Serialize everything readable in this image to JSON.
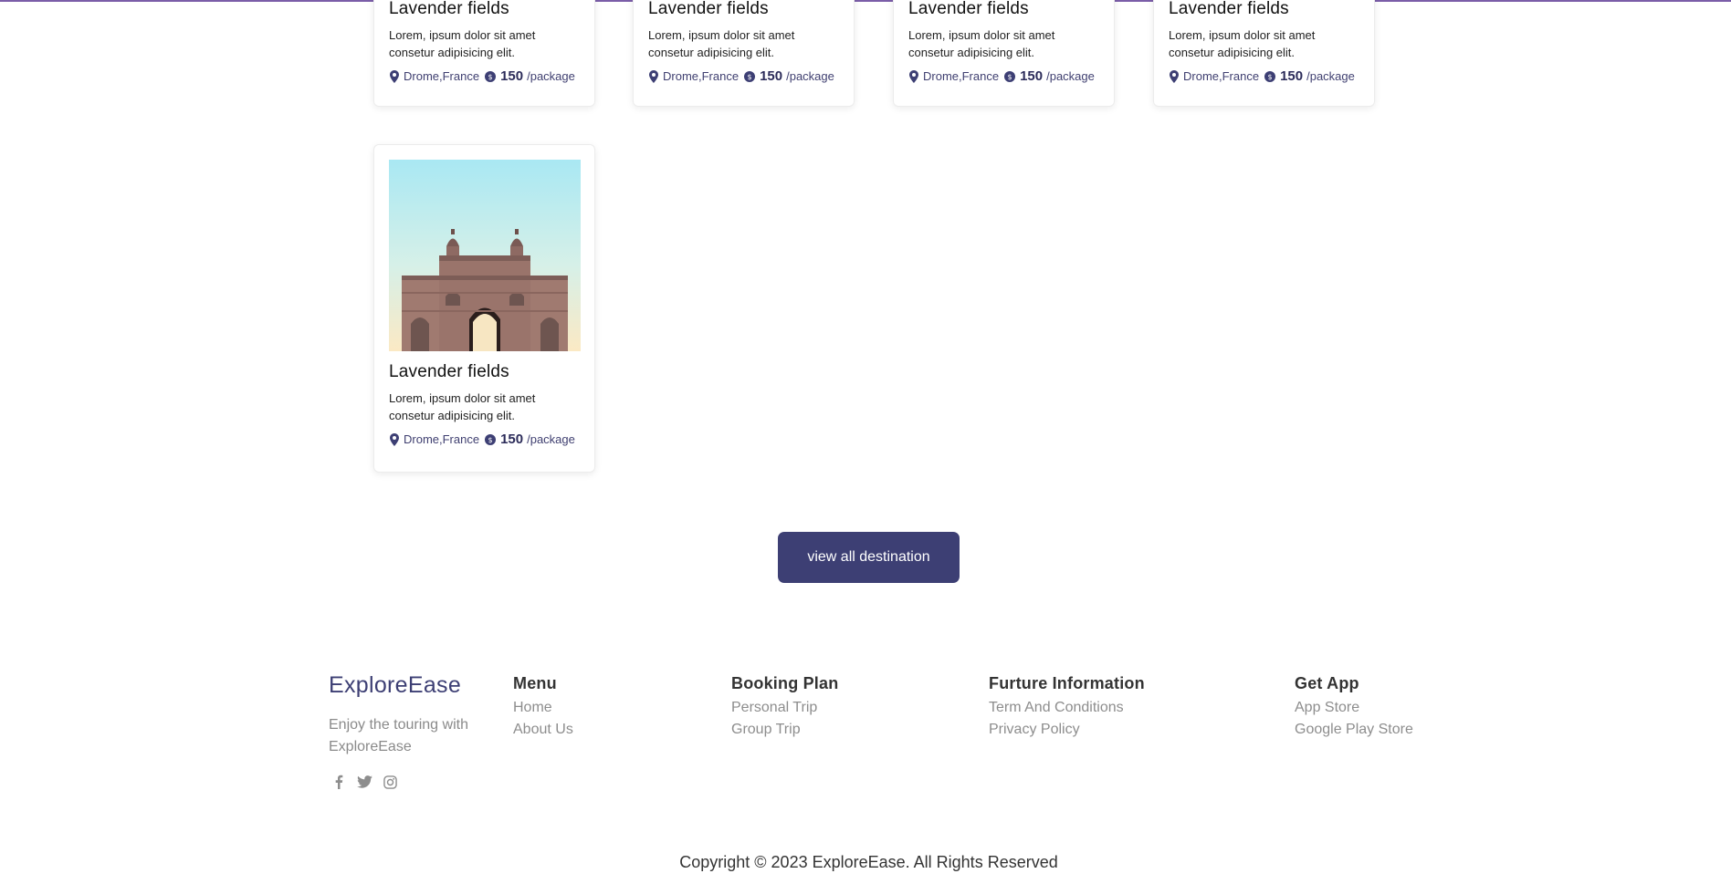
{
  "destinations": [
    {
      "title": "Lavender fields",
      "description": "Lorem, ipsum dolor sit amet consetur adipisicing elit.",
      "location": "Drome,France",
      "price": "150",
      "price_unit": "/package"
    },
    {
      "title": "Lavender fields",
      "description": "Lorem, ipsum dolor sit amet consetur adipisicing elit.",
      "location": "Drome,France",
      "price": "150",
      "price_unit": "/package"
    },
    {
      "title": "Lavender fields",
      "description": "Lorem, ipsum dolor sit amet consetur adipisicing elit.",
      "location": "Drome,France",
      "price": "150",
      "price_unit": "/package"
    },
    {
      "title": "Lavender fields",
      "description": "Lorem, ipsum dolor sit amet consetur adipisicing elit.",
      "location": "Drome,France",
      "price": "150",
      "price_unit": "/package"
    },
    {
      "title": "Lavender fields",
      "description": "Lorem, ipsum dolor sit amet consetur adipisicing elit.",
      "location": "Drome,France",
      "price": "150",
      "price_unit": "/package",
      "image": "gateway-monument-photo"
    }
  ],
  "view_all_label": "view all destination",
  "footer": {
    "brand": "ExploreEase",
    "tagline": "Enjoy the touring with ExploreEase",
    "social_icons": [
      "facebook-icon",
      "twitter-icon",
      "instagram-icon"
    ],
    "columns": [
      {
        "title": "Menu",
        "links": [
          "Home",
          "About Us"
        ]
      },
      {
        "title": "Booking Plan",
        "links": [
          "Personal Trip",
          "Group Trip"
        ]
      },
      {
        "title": "Furture Information",
        "links": [
          "Term And Conditions",
          "Privacy Policy"
        ]
      },
      {
        "title": "Get App",
        "links": [
          "App Store",
          "Google Play Store"
        ]
      }
    ],
    "copyright": "Copyright © 2023 ExploreEase. All Rights Reserved"
  },
  "colors": {
    "primary": "#3d3f74",
    "accent_line": "#7b5ea8",
    "muted_text": "#8d8d8d"
  }
}
